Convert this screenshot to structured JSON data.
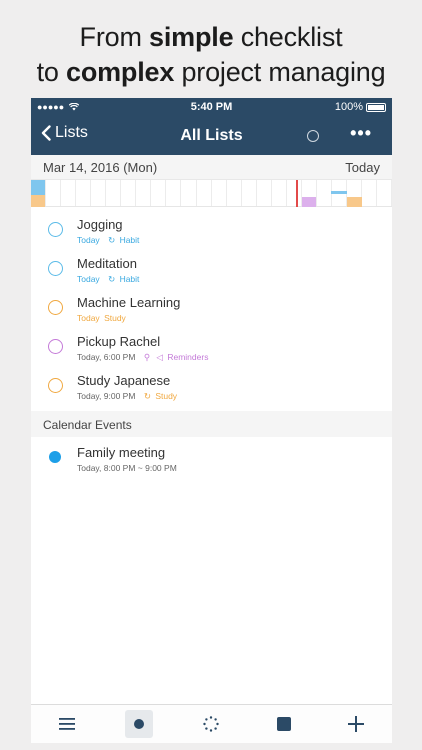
{
  "headline": {
    "line1_pre": "From ",
    "line1_bold": "simple",
    "line1_post": " checklist",
    "line2_pre": "to ",
    "line2_bold": "complex",
    "line2_post": " project managing"
  },
  "status_bar": {
    "signal": "●●●●●",
    "time": "5:40 PM",
    "battery": "100%"
  },
  "nav": {
    "back_label": "Lists",
    "title": "All Lists",
    "more_label": "•••"
  },
  "date_bar": {
    "date": "Mar 14, 2016 (Mon)",
    "today_label": "Today"
  },
  "tasks": [
    {
      "title": "Jogging",
      "meta": "Today",
      "tag": "Habit",
      "tag_icon": "repeat-icon",
      "color": "#3aa9e0"
    },
    {
      "title": "Meditation",
      "meta": "Today",
      "tag": "Habit",
      "tag_icon": "repeat-icon",
      "color": "#3aa9e0"
    },
    {
      "title": "Machine Learning",
      "meta": "Today",
      "tag": "Study",
      "color": "#f0a840"
    },
    {
      "title": "Pickup Rachel",
      "meta": "Today, 6:00 PM",
      "tag": "Reminders",
      "color": "#c47ad8"
    },
    {
      "title": "Study Japanese",
      "meta": "Today, 9:00 PM",
      "tag": "Study",
      "tag_icon": "repeat-icon",
      "color": "#f0a840"
    }
  ],
  "calendar": {
    "header": "Calendar Events",
    "events": [
      {
        "title": "Family meeting",
        "meta": "Today, 8:00 PM ~ 9:00 PM",
        "color": "#1d9fe8"
      }
    ]
  },
  "colors": {
    "nav_bg": "#2b4a66",
    "accent_blue": "#3aa9e0",
    "accent_orange": "#f0a840",
    "accent_purple": "#c47ad8"
  },
  "tab_bar": {
    "tabs": [
      "menu-icon",
      "record-icon",
      "spinner-icon",
      "stop-icon",
      "plus-icon"
    ]
  }
}
